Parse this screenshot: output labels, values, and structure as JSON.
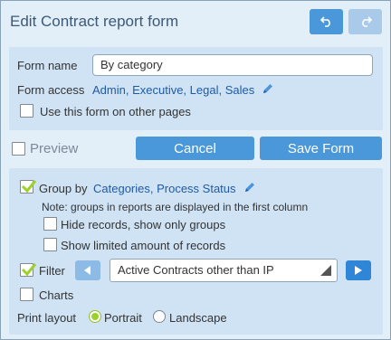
{
  "header": {
    "title": "Edit Contract report form",
    "undo_icon": "undo-icon",
    "redo_icon": "redo-icon"
  },
  "form": {
    "name_label": "Form name",
    "name_value": "By category",
    "access_label": "Form access",
    "access_value": "Admin, Executive, Legal, Sales",
    "other_pages_label": "Use this form on other pages",
    "other_pages_checked": false
  },
  "actions": {
    "preview_label": "Preview",
    "cancel_label": "Cancel",
    "save_label": "Save Form"
  },
  "options": {
    "group_by_label": "Group by",
    "group_by_checked": true,
    "group_by_value": "Categories, Process Status",
    "group_note": "Note: groups in reports are displayed in the first column",
    "hide_records_label": "Hide records, show only groups",
    "limited_label": "Show limited amount of records",
    "filter_label": "Filter",
    "filter_checked": true,
    "filter_value": "Active Contracts other than IP",
    "charts_label": "Charts",
    "print_layout_label": "Print layout",
    "portrait_label": "Portrait",
    "landscape_label": "Landscape",
    "selected_layout": "Portrait"
  },
  "colors": {
    "accent": "#4a97d9",
    "panel": "#cfe3f5",
    "link": "#1f5aa6",
    "check": "#9ad12a"
  }
}
